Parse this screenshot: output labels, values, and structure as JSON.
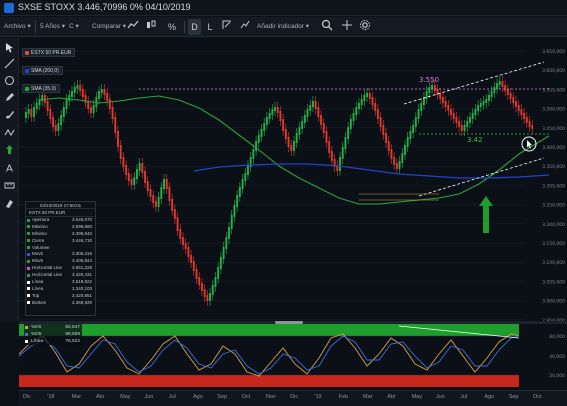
{
  "window": {
    "title": "SXSE STOXX 3.446,70996 0% 04/10/2019"
  },
  "toolbar": {
    "archivo": "Archivo",
    "period": "5 Años",
    "interval": "C",
    "compare": "Comparar",
    "draw_d": "D",
    "draw_l": "L",
    "add_indicator": "Añadir indicador"
  },
  "legend": {
    "symbol": "ESTX 50 PR.EUR",
    "sma200": "SMA (200,0)",
    "sma35": "SMA (35,0)"
  },
  "info_panel": {
    "timestamp": "04/10/2019 17:50:01",
    "symbol": "ESTX 50 PR.EUR",
    "rows": [
      {
        "label": "Apertura",
        "value": "3.545,070",
        "color": "#2e9e3e"
      },
      {
        "label": "Máximo",
        "value": "3.598,680",
        "color": "#2e9e3e"
      },
      {
        "label": "Mínimo",
        "value": "3.398,840",
        "color": "#2e9e3e"
      },
      {
        "label": "Cierre",
        "value": "3.446,710",
        "color": "#2e9e3e"
      },
      {
        "label": "Volumen",
        "value": "",
        "color": "#2e9e3e"
      },
      {
        "label": "Mov5",
        "value": "3.306,319",
        "color": "#2a5bd8"
      },
      {
        "label": "Mov5",
        "value": "3.406,844",
        "color": "#2e9e3e"
      },
      {
        "label": "Horizontal Line",
        "value": "3.551,228",
        "color": "#d64fd0"
      },
      {
        "label": "Horizontal Line",
        "value": "3.426,431",
        "color": "#2e9e3e"
      },
      {
        "label": "Línea",
        "value": "3.618,822",
        "color": "#ffffff"
      },
      {
        "label": "Línea",
        "value": "3.340,103",
        "color": "#ffffff"
      },
      {
        "label": "Top",
        "value": "3.420,851",
        "color": "#ffffff"
      },
      {
        "label": "Bottom",
        "value": "3.368,920",
        "color": "#ffffff"
      }
    ]
  },
  "annotations": {
    "upper_level": "3.550",
    "lower_level": "3.42",
    "channel_top_label": "Línea",
    "channel_bottom_label": "Línea"
  },
  "price_axis": [
    "3.650,000",
    "3.600,000",
    "3.550,000",
    "3.500,000",
    "3.450,000",
    "3.400,000",
    "3.350,000",
    "3.300,000",
    "3.250,000",
    "3.200,000",
    "3.150,000",
    "3.100,000",
    "3.050,000",
    "3.000,000",
    "2.950,000"
  ],
  "osc": {
    "rows": [
      {
        "label": "%K5",
        "value": "82,647",
        "color": "#d6a04a"
      },
      {
        "label": "%D5",
        "value": "88,559",
        "color": "#3a6fe0"
      },
      {
        "label": "Línea",
        "value": "76,522",
        "color": "#ffffff"
      }
    ],
    "axis": [
      "80,000",
      "40,000",
      "20,000"
    ]
  },
  "time_axis": [
    "Dic",
    "'18",
    "Mar",
    "Abr",
    "May",
    "Jun",
    "Jul",
    "Ago",
    "Sep",
    "Oct",
    "Nov",
    "Dic",
    "'19",
    "Feb",
    "Mar",
    "Abr",
    "May",
    "Jun",
    "Jul",
    "Ago",
    "Sep",
    "Oct"
  ],
  "colors": {
    "up": "#22b34a",
    "down": "#e2382e",
    "sma200": "#1f45c8",
    "sma35": "#2ea33a",
    "hline_upper": "#d97bd6",
    "hline_lower": "#3fbf3f",
    "osc_upper": "#1f9e2e",
    "osc_lower": "#c8281c"
  }
}
